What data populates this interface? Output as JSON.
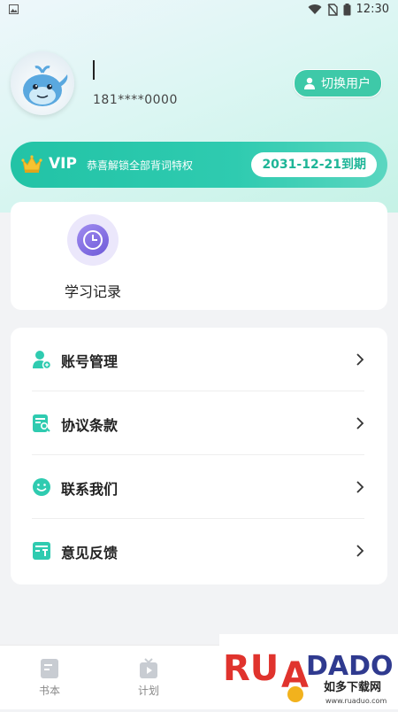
{
  "status_bar": {
    "time": "12:30"
  },
  "profile": {
    "phone": "181****0000",
    "switch_label": "切换用户"
  },
  "vip": {
    "title": "VIP",
    "description": "恭喜解锁全部背词特权",
    "expiry": "2031-12-21到期"
  },
  "study": {
    "label": "学习记录"
  },
  "menu": {
    "items": [
      {
        "label": "账号管理",
        "icon": "account-icon"
      },
      {
        "label": "协议条款",
        "icon": "agreement-icon"
      },
      {
        "label": "联系我们",
        "icon": "smile-icon"
      },
      {
        "label": "意见反馈",
        "icon": "feedback-icon"
      }
    ]
  },
  "tabs": [
    {
      "label": "书本",
      "icon": "book-icon"
    },
    {
      "label": "计划",
      "icon": "plan-icon"
    }
  ],
  "watermark": {
    "brand": "RUANDADO",
    "sub": "如多下载网",
    "url": "www.ruaduo.com"
  },
  "colors": {
    "accent": "#2fcbb0",
    "vip_text": "#1db597",
    "study_purple": "#7a66e0"
  }
}
